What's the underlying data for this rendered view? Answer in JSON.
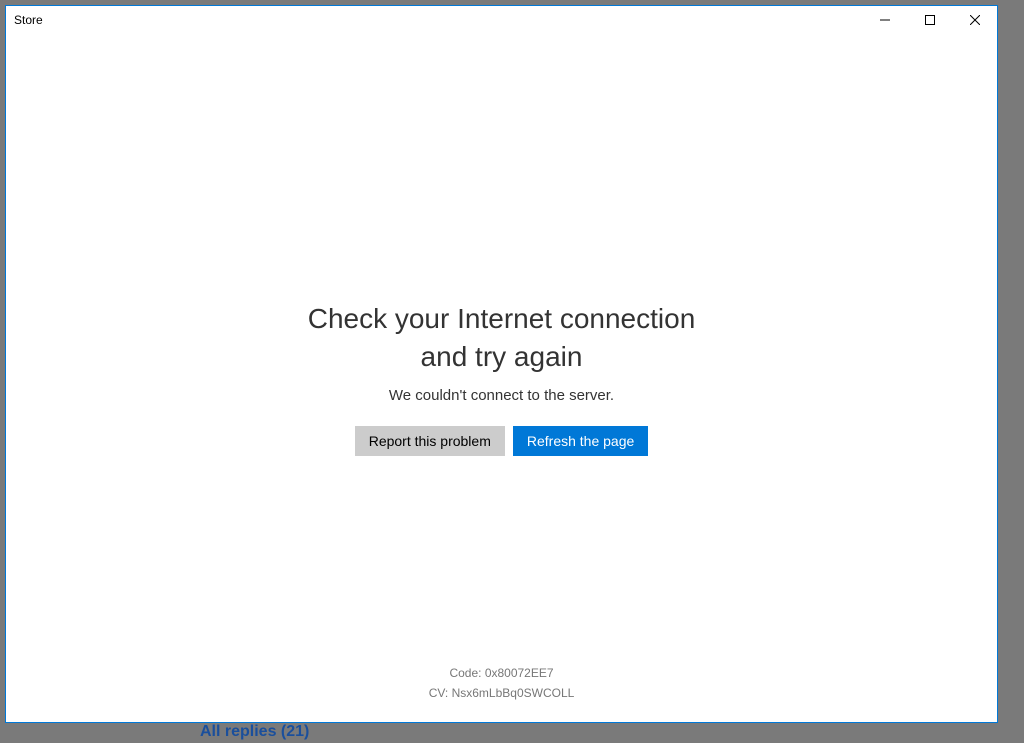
{
  "window": {
    "title": "Store"
  },
  "error": {
    "heading": "Check your Internet connection\nand try again",
    "subtext": "We couldn't connect to the server.",
    "report_button": "Report this problem",
    "refresh_button": "Refresh the page"
  },
  "footer": {
    "code_label": "Code:",
    "code_value": "0x80072EE7",
    "cv_label": "CV:",
    "cv_value": "Nsx6mLbBq0SWCOLL"
  },
  "behind": {
    "replies_text": "All replies (21)"
  }
}
